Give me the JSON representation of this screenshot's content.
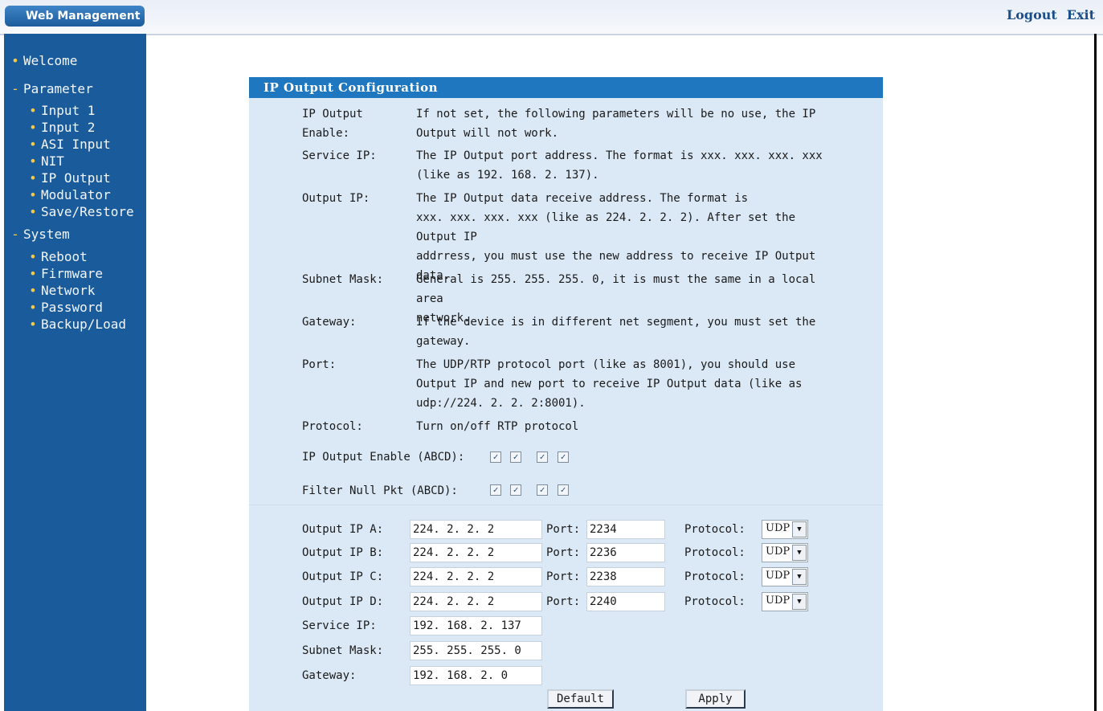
{
  "header": {
    "brand": "Web Management",
    "logout": "Logout",
    "exit": "Exit"
  },
  "sidebar": {
    "welcome": "Welcome",
    "parameter": {
      "label": "Parameter",
      "items": [
        "Input 1",
        "Input 2",
        "ASI Input",
        "NIT",
        "IP Output",
        "Modulator",
        "Save/Restore"
      ]
    },
    "system": {
      "label": "System",
      "items": [
        "Reboot",
        "Firmware",
        "Network",
        "Password",
        "Backup/Load"
      ]
    }
  },
  "panel": {
    "title": "IP Output Configuration",
    "help": [
      {
        "label": [
          "IP Output",
          "Enable:"
        ],
        "text": [
          "If not set, the following parameters will be no use,  the IP",
          "Output will not work."
        ]
      },
      {
        "label": [
          "Service IP:"
        ],
        "text": [
          "The IP Output port address. The format is xxx. xxx. xxx. xxx",
          "(like as 192. 168. 2. 137)."
        ]
      },
      {
        "label": [
          "Output IP:"
        ],
        "text": [
          "The IP Output data receive address. The format is",
          "xxx. xxx. xxx. xxx (like as 224. 2. 2. 2).  After set the Output IP",
          "addrress, you must use the new address to receive IP Output",
          "data."
        ]
      },
      {
        "label": [
          "Subnet Mask:"
        ],
        "text": [
          "General is 255. 255. 255. 0, it is must the same in a local area",
          "network."
        ]
      },
      {
        "label": [
          "Gateway:"
        ],
        "text": [
          "If the device is in different net segment, you must set the",
          "gateway."
        ]
      },
      {
        "label": [
          "Port:"
        ],
        "text": [
          "The UDP/RTP protocol port (like as 8001),  you should use",
          "Output IP and new port to receive IP Output data (like as",
          "udp://224. 2. 2. 2:8001)."
        ]
      },
      {
        "label": [
          "Protocol:"
        ],
        "text": [
          "Turn on/off RTP protocol"
        ]
      }
    ],
    "enable_label": "IP Output Enable (ABCD):",
    "filter_label": "Filter Null Pkt (ABCD):",
    "enable_checks": [
      true,
      true,
      true,
      true
    ],
    "filter_checks": [
      true,
      true,
      true,
      true
    ],
    "outputs": [
      {
        "label": "Output IP A:",
        "ip": "224. 2. 2. 2",
        "port": "2234",
        "protocol": "UDP"
      },
      {
        "label": "Output IP B:",
        "ip": "224. 2. 2. 2",
        "port": "2236",
        "protocol": "UDP"
      },
      {
        "label": "Output IP C:",
        "ip": "224. 2. 2. 2",
        "port": "2238",
        "protocol": "UDP"
      },
      {
        "label": "Output IP D:",
        "ip": "224. 2. 2. 2",
        "port": "2240",
        "protocol": "UDP"
      }
    ],
    "port_label": "Port:",
    "protocol_label": "Protocol:",
    "service_ip": {
      "label": "Service IP:",
      "value": "192. 168. 2. 137"
    },
    "subnet_mask": {
      "label": "Subnet Mask:",
      "value": "255. 255. 255. 0"
    },
    "gateway": {
      "label": "Gateway:",
      "value": "192. 168. 2. 0"
    },
    "buttons": {
      "default": "Default",
      "apply": "Apply"
    }
  }
}
